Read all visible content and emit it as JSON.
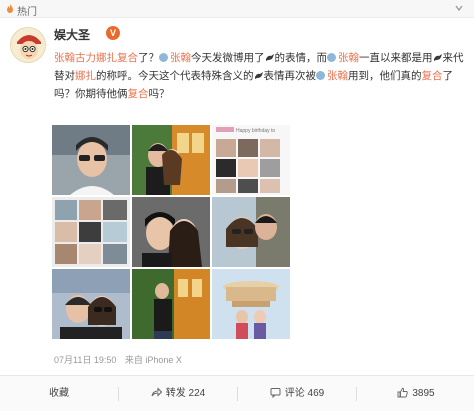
{
  "topbar": {
    "label": "热门",
    "icon": "fire-icon"
  },
  "post": {
    "author": "娱大圣",
    "segments": [
      {
        "t": "张翰古力娜扎复合",
        "c": "topic"
      },
      {
        "t": "了？",
        "c": ""
      },
      {
        "t": "张翰",
        "c": "mention"
      },
      {
        "t": "今天发微博用了",
        "c": ""
      },
      {
        "t": "",
        "c": "bird"
      },
      {
        "t": "的表情，而",
        "c": ""
      },
      {
        "t": "张翰",
        "c": "mention"
      },
      {
        "t": "一直以来都是用",
        "c": ""
      },
      {
        "t": "",
        "c": "bird"
      },
      {
        "t": "来代替对",
        "c": ""
      },
      {
        "t": "娜扎",
        "c": "topic"
      },
      {
        "t": "的称呼。今天这个代表特殊含义的",
        "c": ""
      },
      {
        "t": "",
        "c": "bird"
      },
      {
        "t": "表情再次被",
        "c": ""
      },
      {
        "t": "张翰",
        "c": "mention"
      },
      {
        "t": "用到，他们真的",
        "c": ""
      },
      {
        "t": "复合",
        "c": "topic"
      },
      {
        "t": "了吗？你期待他俩",
        "c": ""
      },
      {
        "t": "复合",
        "c": "topic"
      },
      {
        "t": "吗？",
        "c": ""
      }
    ],
    "photo_caption": "Happy birthday to",
    "timestamp": "07月11日 19:50",
    "source": "来自 iPhone X"
  },
  "actions": {
    "favorite": "收藏",
    "share": "转发 224",
    "comment": "评论 469",
    "like": "3895"
  },
  "colors": {
    "accent": "#eb7350",
    "badge": "#e86b2b"
  }
}
